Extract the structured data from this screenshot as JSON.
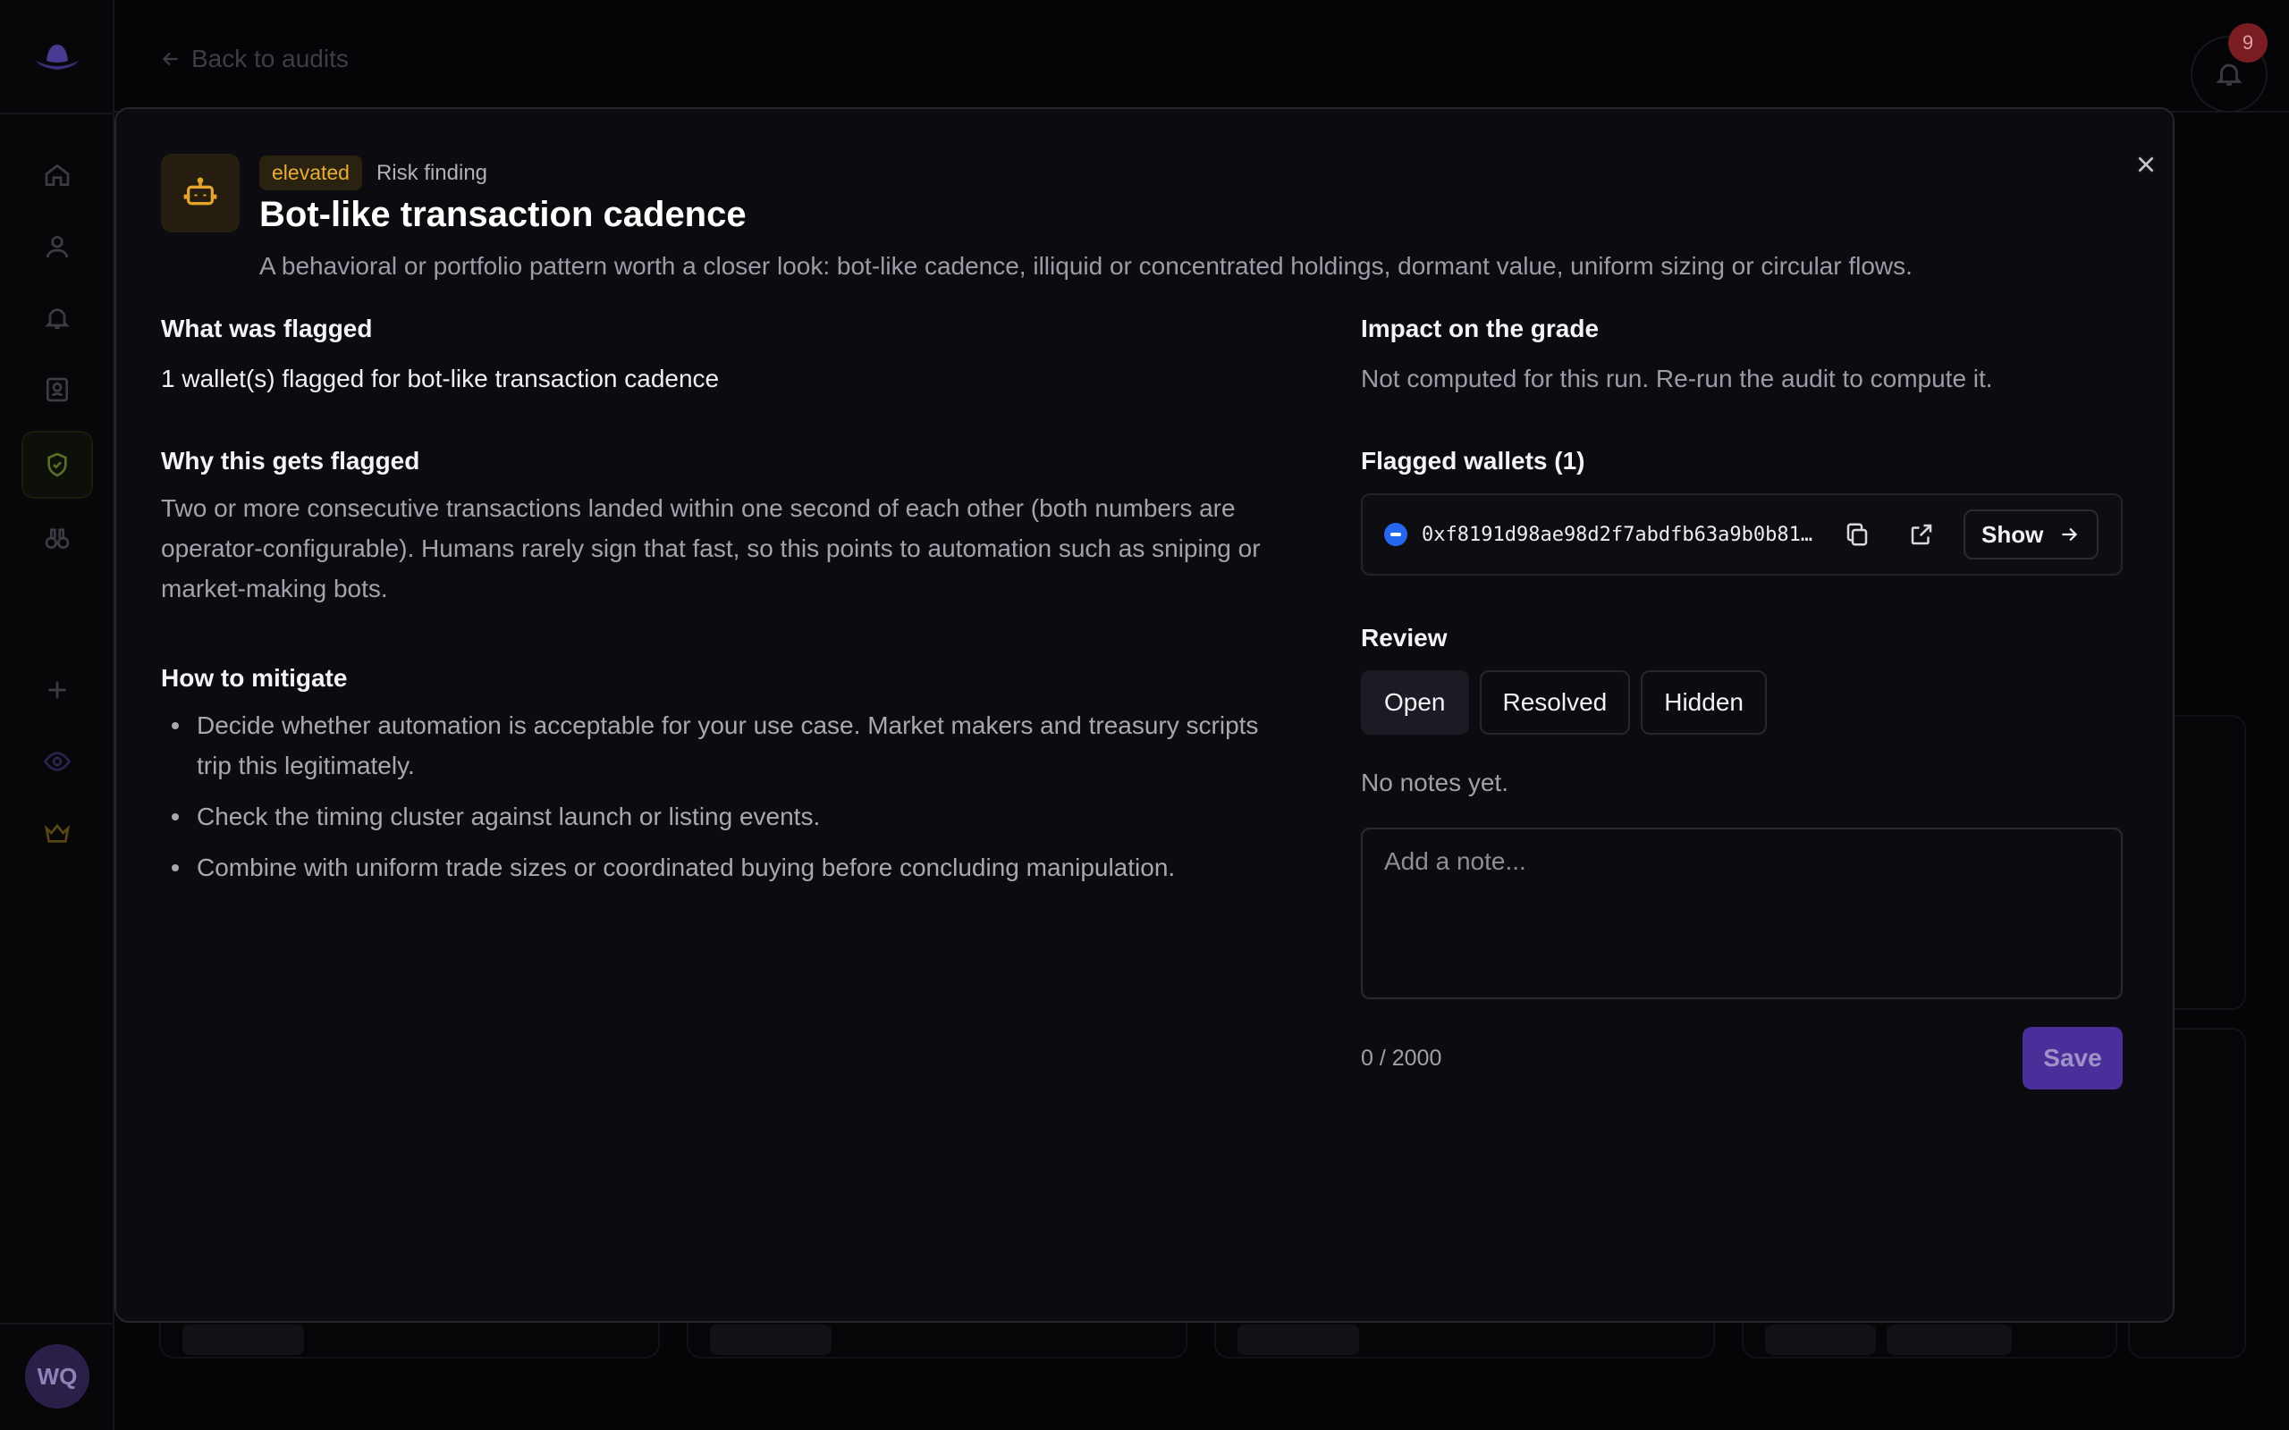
{
  "app": {
    "user_initials": "WQ",
    "notification_count": "9",
    "back_link": "Back to audits"
  },
  "finding": {
    "severity": "elevated",
    "kind": "Risk finding",
    "title": "Bot-like transaction cadence",
    "subtitle": "A behavioral or portfolio pattern worth a closer look: bot-like cadence, illiquid or concentrated holdings, dormant value, uniform sizing or circular flows.",
    "icon": "robot-icon"
  },
  "flagged": {
    "title": "What was flagged",
    "text": "1 wallet(s) flagged for bot-like transaction cadence"
  },
  "why": {
    "title": "Why this gets flagged",
    "text": "Two or more consecutive transactions landed within one second of each other (both numbers are operator-configurable). Humans rarely sign that fast, so this points to automation such as sniping or market-making bots."
  },
  "mitigate": {
    "title": "How to mitigate",
    "items": [
      "Decide whether automation is acceptable for your use case. Market makers and treasury scripts trip this legitimately.",
      "Check the timing cluster against launch or listing events.",
      "Combine with uniform trade sizes or coordinated buying before concluding manipulation."
    ]
  },
  "impact": {
    "title": "Impact on the grade",
    "text": "Not computed for this run. Re-run the audit to compute it."
  },
  "wallets": {
    "title": "Flagged wallets (1)",
    "items": [
      {
        "address": "0xf8191d98ae98d2f7abdfb63a9b0b81…",
        "show_label": "Show"
      }
    ]
  },
  "review": {
    "title": "Review",
    "options": [
      "Open",
      "Resolved",
      "Hidden"
    ],
    "selected": "Open",
    "notes_empty": "No notes yet.",
    "note_placeholder": "Add a note...",
    "note_value": "",
    "char_count": "0 / 2000",
    "save_label": "Save"
  },
  "colors": {
    "accent": "#4a2f9a",
    "severity": "#e9ad33",
    "background": "#050507",
    "modal": "#0c0c10",
    "chain": "#2667f0"
  }
}
